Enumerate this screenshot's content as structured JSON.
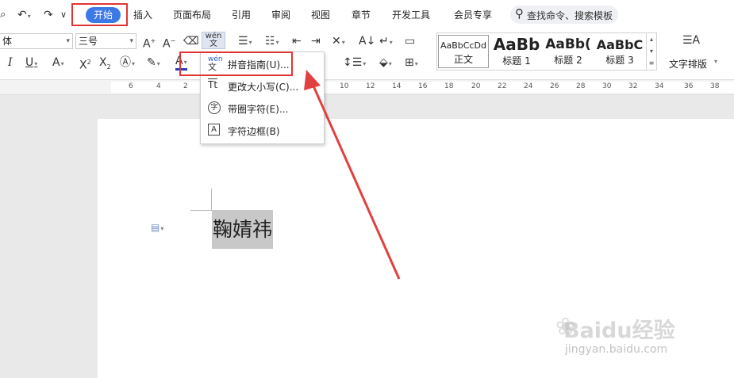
{
  "menubar": {
    "tabs": [
      "开始",
      "插入",
      "页面布局",
      "引用",
      "审阅",
      "视图",
      "章节",
      "开发工具",
      "会员专享"
    ],
    "search_placeholder": "查找命令、搜索模板"
  },
  "ribbon": {
    "font_name": "体",
    "font_size": "三号",
    "styles": [
      {
        "sample": "AaBbCcDd",
        "name": "正文"
      },
      {
        "sample": "AaBb",
        "name": "标题 1"
      },
      {
        "sample": "AaBb(",
        "name": "标题 2"
      },
      {
        "sample": "AaBbC",
        "name": "标题 3"
      }
    ],
    "text_layout_label": "文字排版"
  },
  "ruler": {
    "numbers": [
      "6",
      "4",
      "2",
      "10",
      "12",
      "14",
      "16",
      "18",
      "20",
      "22",
      "24",
      "26",
      "28",
      "30",
      "32",
      "34",
      "36",
      "38"
    ]
  },
  "dropdown": {
    "items": [
      {
        "icon": "wen-pinyin-icon",
        "label": "拼音指南(U)..."
      },
      {
        "icon": "change-case-icon",
        "label": "更改大小写(C)..."
      },
      {
        "icon": "enclosed-character-icon",
        "label": "带圈字符(E)..."
      },
      {
        "icon": "character-border-icon",
        "label": "字符边框(B)"
      }
    ]
  },
  "document": {
    "selected_text": "鞠婧祎"
  },
  "watermark": {
    "brand": "Baidu经验",
    "url": "jingyan.baidu.com"
  },
  "colors": {
    "accent": "#3c78e6",
    "highlight_frame": "#e03535",
    "selection": "#c8c8c8"
  }
}
